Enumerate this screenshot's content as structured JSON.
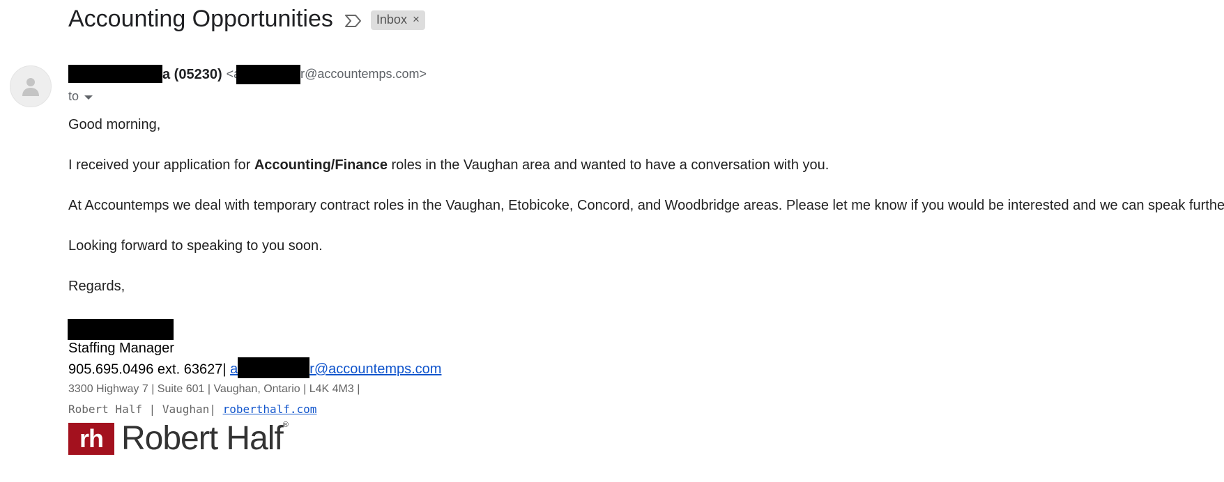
{
  "email": {
    "subject": "Accounting Opportunities",
    "label_icon": "label-icon",
    "label": "Inbox",
    "label_remove": "×",
    "sender": {
      "name_visible": "a (05230)",
      "email_open": "<a",
      "email_mid": "a",
      "email_visible": "r@accountemps.com>"
    },
    "recipient_label": "to",
    "body": {
      "greeting": "Good morning,",
      "p1_prefix": "I received your application for ",
      "p1_bold": "Accounting/Finance",
      "p1_suffix": " roles in the Vaughan area and wanted to have a conversation with you.",
      "p2": "At Accountemps we deal with temporary contract roles in the Vaughan, Etobicoke, Concord, and Woodbridge areas. Please let me know if you would be interested and we can speak further.",
      "p3": "Looking forward to speaking to you soon.",
      "closing": "Regards,"
    },
    "signature": {
      "title": "Staffing Manager",
      "phone": "905.695.0496 ext. 63627|",
      "email_start": "a",
      "email_end": "r@accountemps.com",
      "address": "3300 Highway 7 | Suite 601 | Vaughan, Ontario | L4K 4M3 |",
      "company_line": "Robert Half | Vaughan| ",
      "website": "roberthalf.com",
      "logo_mark": "rh",
      "logo_text": "Robert Half",
      "logo_reg": "®"
    }
  },
  "colors": {
    "link": "#1155cc",
    "brand": "#a3111e"
  }
}
